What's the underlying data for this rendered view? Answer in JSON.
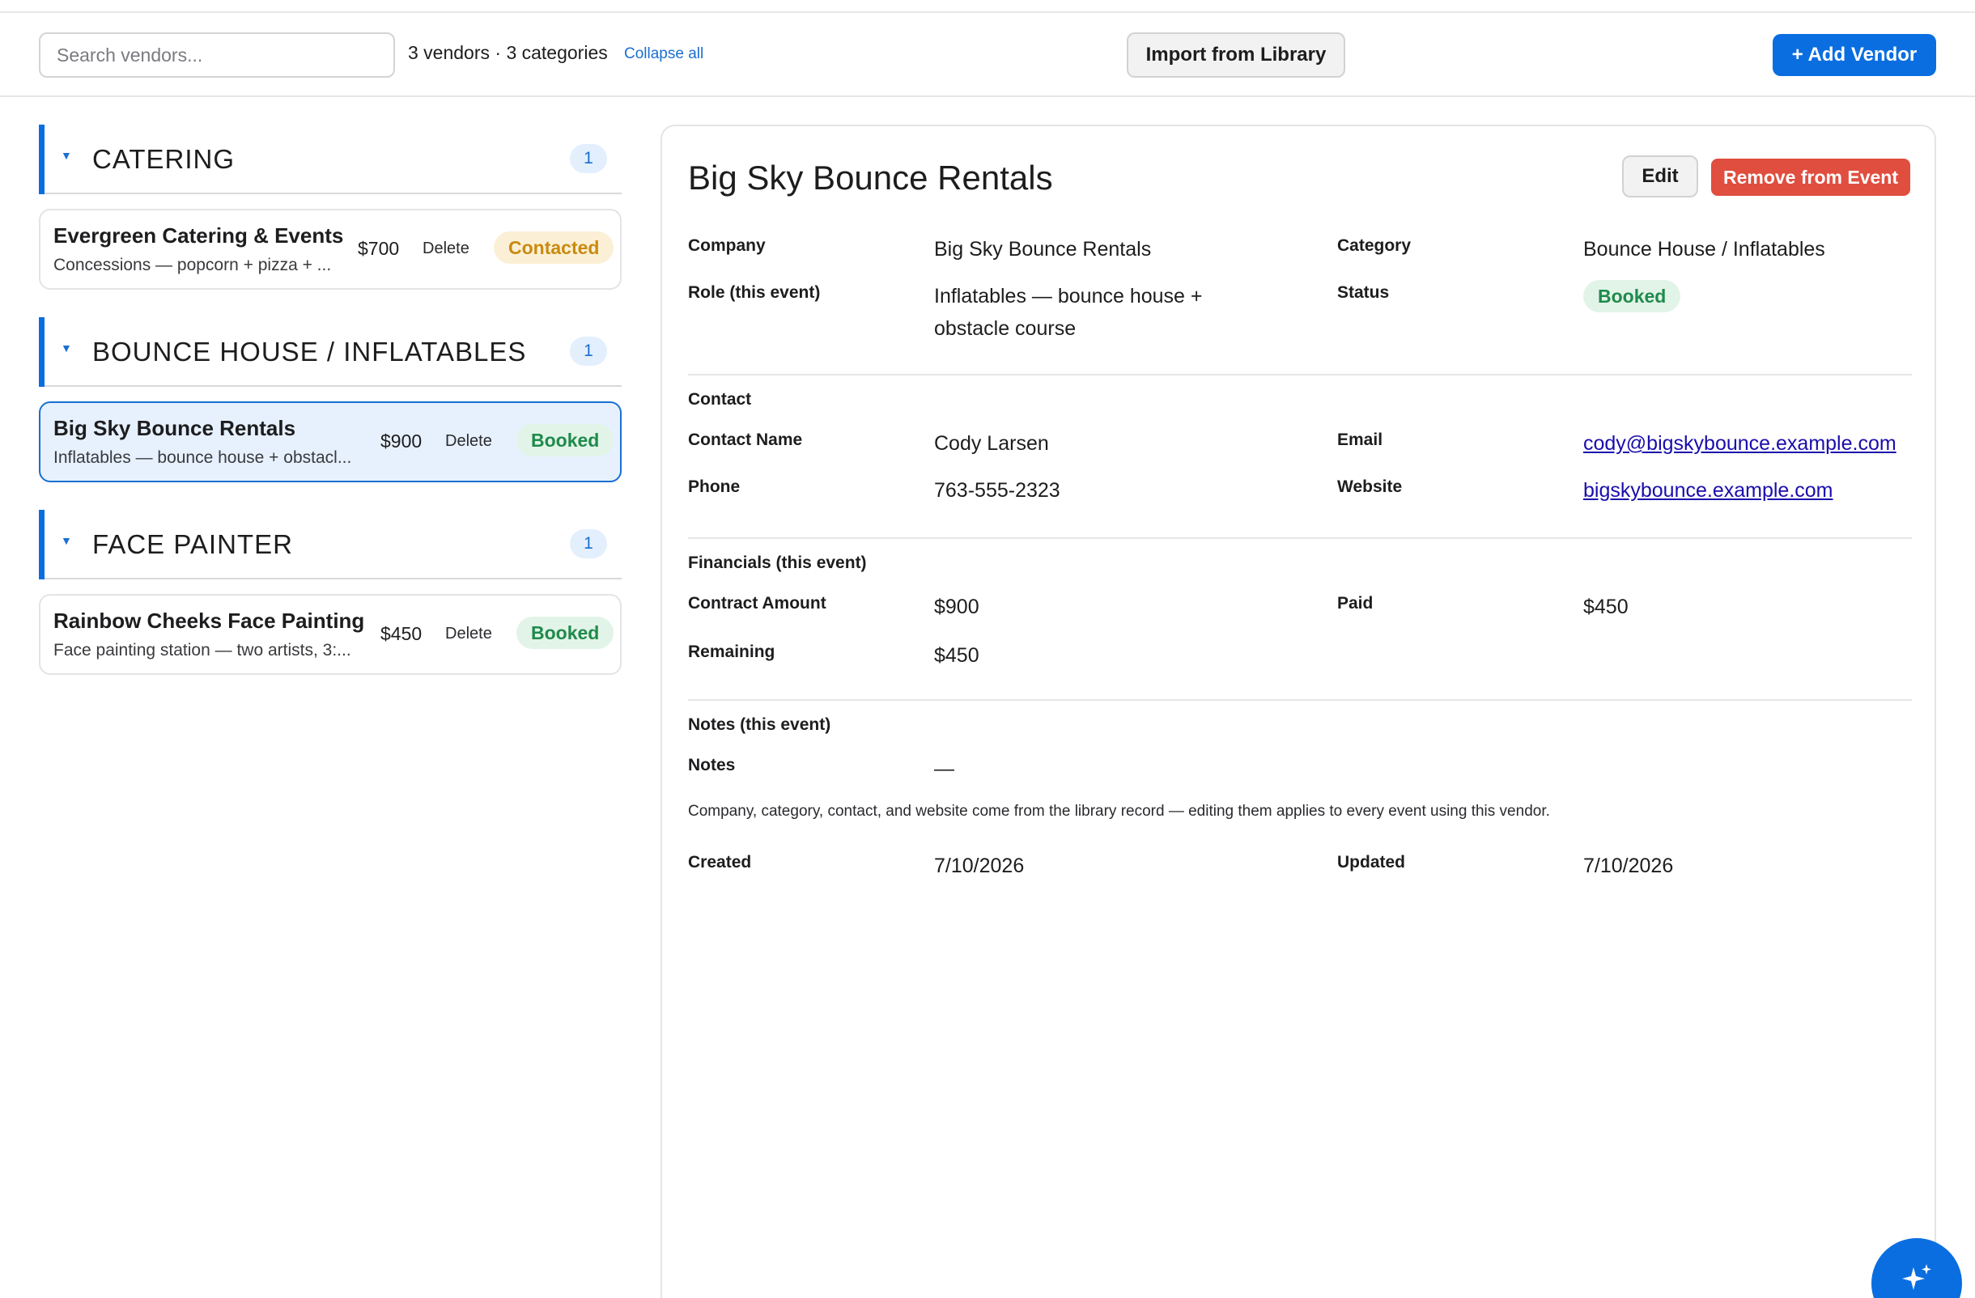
{
  "toolbar": {
    "search_placeholder": "Search vendors...",
    "summary": "3 vendors · 3 categories",
    "collapse_all": "Collapse all",
    "import_label": "Import from Library",
    "add_label": "+ Add Vendor"
  },
  "categories": [
    {
      "name": "CATERING",
      "count": "1",
      "vendors": [
        {
          "name": "Evergreen Catering & Events",
          "role": "Concessions — popcorn + pizza + ...",
          "price": "$700",
          "delete": "Delete",
          "status": "Contacted"
        }
      ]
    },
    {
      "name": "BOUNCE HOUSE / INFLATABLES",
      "count": "1",
      "vendors": [
        {
          "name": "Big Sky Bounce Rentals",
          "role": "Inflatables — bounce house + obstacl...",
          "price": "$900",
          "delete": "Delete",
          "status": "Booked",
          "selected": true
        }
      ]
    },
    {
      "name": "FACE PAINTER",
      "count": "1",
      "vendors": [
        {
          "name": "Rainbow Cheeks Face Painting",
          "role": "Face painting station — two artists, 3:...",
          "price": "$450",
          "delete": "Delete",
          "status": "Booked"
        }
      ]
    }
  ],
  "detail": {
    "title": "Big Sky Bounce Rentals",
    "edit_label": "Edit",
    "remove_label": "Remove from Event",
    "company_label": "Company",
    "company": "Big Sky Bounce Rentals",
    "category_label": "Category",
    "category": "Bounce House / Inflatables",
    "role_label": "Role (this event)",
    "role": "Inflatables — bounce house + obstacle course",
    "status_label": "Status",
    "status": "Booked",
    "contact_section": "Contact",
    "contact_name_label": "Contact Name",
    "contact_name": "Cody Larsen",
    "email_label": "Email",
    "email": "cody@bigskybounce.example.com",
    "phone_label": "Phone",
    "phone": "763-555-2323",
    "website_label": "Website",
    "website": "bigskybounce.example.com",
    "financials_section": "Financials (this event)",
    "contract_label": "Contract Amount",
    "contract": "$900",
    "paid_label": "Paid",
    "paid": "$450",
    "remaining_label": "Remaining",
    "remaining": "$450",
    "notes_section": "Notes (this event)",
    "notes_label": "Notes",
    "notes": "—",
    "hint": "Company, category, contact, and website come from the library record — editing them applies to every event using this vendor.",
    "created_label": "Created",
    "created": "7/10/2026",
    "updated_label": "Updated",
    "updated": "7/10/2026"
  },
  "colors": {
    "accent": "#0a6ee0",
    "danger": "#e04e3f",
    "booked_bg": "#e2f4e8",
    "booked_text": "#1f8a4c",
    "contacted_bg": "#fbf0d6",
    "contacted_text": "#c98a10",
    "selected_bg": "#e6f1fd"
  },
  "icons": {
    "fab": "sparkle-icon",
    "category_toggle": "caret-down-icon"
  }
}
